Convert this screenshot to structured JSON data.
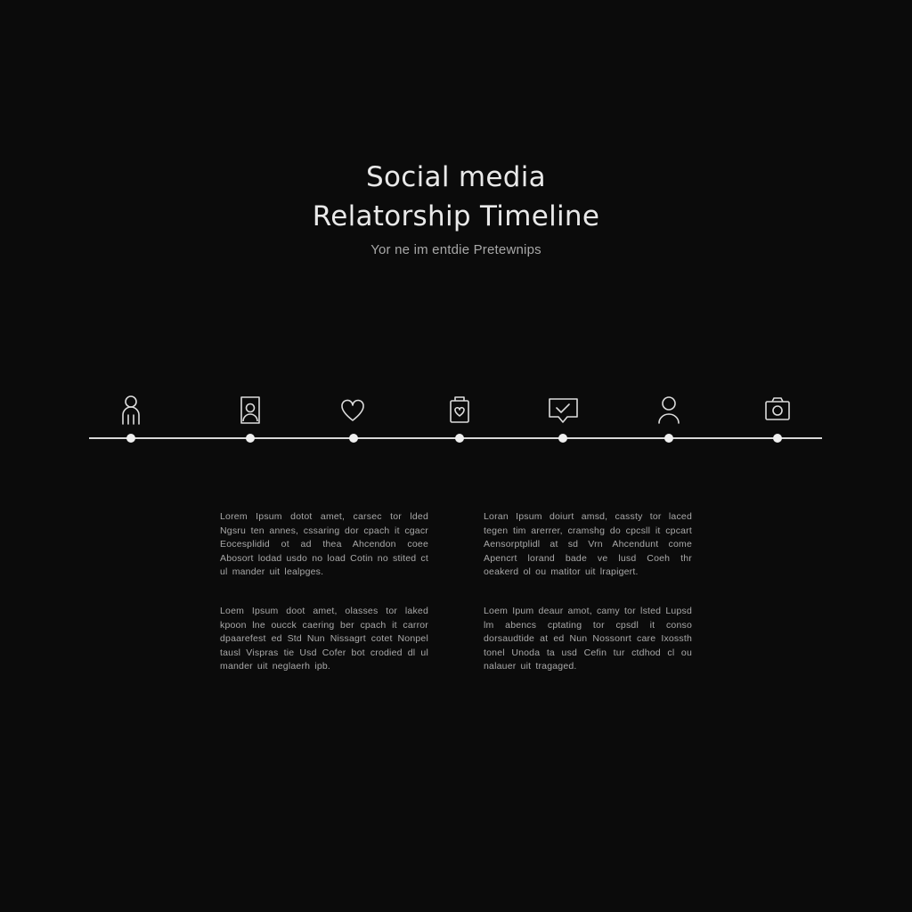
{
  "header": {
    "title_line1": "Social media",
    "title_line2": "Relatorship Timeline",
    "subtitle": "Yor ne im entdie Pretewnips"
  },
  "timeline": {
    "milestones": [
      {
        "icon": "person-icon"
      },
      {
        "icon": "profile-picture-icon"
      },
      {
        "icon": "heart-icon"
      },
      {
        "icon": "bag-icon"
      },
      {
        "icon": "message-check-icon"
      },
      {
        "icon": "user-icon"
      },
      {
        "icon": "camera-icon"
      }
    ]
  },
  "paragraphs": {
    "left_1": "Lorem Ipsum dotot amet, carsec tor lded Ngsru ten annes, cssaring dor cpach it cgacr Eocesplidid ot ad thea Ahcendon coee Abosort lodad usdo no load Cotin no stited ct ul mander uit lealpges.",
    "left_2": "Loem Ipsum doot amet, olasses tor laked kpoon lne oucck caering ber cpach it carror dpaarefest ed Std Nun Nissagrt cotet Nonpel tausl Vispras tie Usd Cofer bot crodied dl ul mander uit neglaerh ipb.",
    "right_1": "Loran Ipsum doiurt amsd, cassty tor laced tegen tim arerrer, cramshg do cpcsll it cpcart Aensorptplidl at sd Vrn Ahcendunt come Apencrt lorand bade ve lusd Coeh thr oeakerd ol ou matitor uit lrapigert.",
    "right_2": "Loem Ipum deaur amot, camy tor lsted Lupsd lm abencs cptating tor cpsdl it conso dorsaudtide at ed Nun Nossonrt care Ixossth tonel Unoda ta usd Cefin tur ctdhod cl ou nalauer uit tragaged."
  }
}
